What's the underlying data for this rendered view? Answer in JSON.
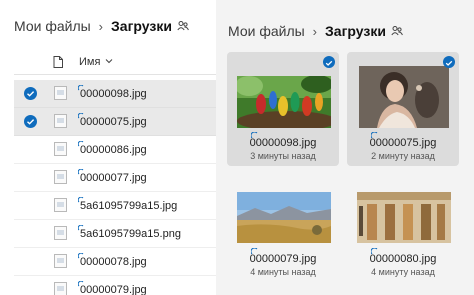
{
  "breadcrumb": {
    "root": "Мои файлы",
    "separator": "›",
    "current": "Загрузки"
  },
  "list_view": {
    "header": {
      "name_label": "Имя"
    },
    "rows": [
      {
        "name": "00000098.jpg",
        "selected": true
      },
      {
        "name": "00000075.jpg",
        "selected": true
      },
      {
        "name": "00000086.jpg",
        "selected": false
      },
      {
        "name": "00000077.jpg",
        "selected": false
      },
      {
        "name": "5a61095799a15.jpg",
        "selected": false
      },
      {
        "name": "5a61095799a15.png",
        "selected": false
      },
      {
        "name": "00000078.jpg",
        "selected": false
      },
      {
        "name": "00000079.jpg",
        "selected": false
      }
    ]
  },
  "grid_view": {
    "tiles": [
      {
        "name": "00000098.jpg",
        "modified": "3 минуты назад",
        "selected": true,
        "image": "parrots"
      },
      {
        "name": "00000075.jpg",
        "modified": "2 минуту назад",
        "selected": true,
        "image": "woman-portrait"
      },
      {
        "name": "00000079.jpg",
        "modified": "4 минуты назад",
        "selected": false,
        "image": "landscape"
      },
      {
        "name": "00000080.jpg",
        "modified": "4 минуту назад",
        "selected": false,
        "image": "egyptian-relief"
      }
    ]
  },
  "colors": {
    "accent": "#0f6cbd",
    "selected_bg": "#e9e9e9",
    "pane_bg": "#f3f3f3"
  }
}
